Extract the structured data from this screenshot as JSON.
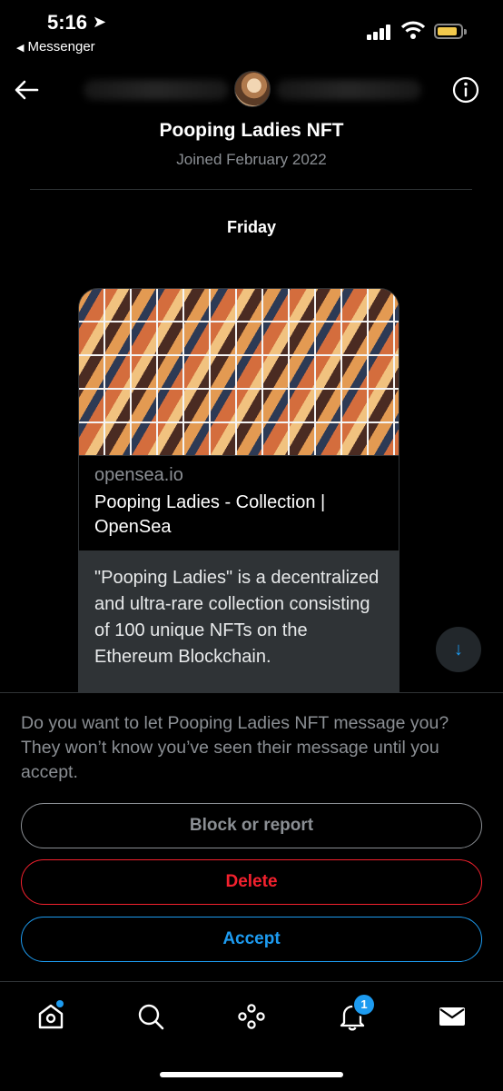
{
  "status_bar": {
    "time": "5:16",
    "back_app": "Messenger"
  },
  "header": {
    "name": "Pooping Ladies NFT",
    "joined": "Joined February 2022"
  },
  "conversation": {
    "day_label": "Friday",
    "card": {
      "domain": "opensea.io",
      "title": "Pooping Ladies - Collection | OpenSea",
      "description": "\"Pooping Ladies\" is a decentralized and ultra-rare collection consisting of 100 unique NFTs on the Ethereum Blockchain."
    }
  },
  "request": {
    "prompt": "Do you want to let Pooping Ladies NFT message you? They won’t know you’ve seen their message until you accept.",
    "block_label": "Block or report",
    "delete_label": "Delete",
    "accept_label": "Accept"
  },
  "tabbar": {
    "notifications_badge": "1"
  },
  "colors": {
    "accent": "#1d9bf0",
    "danger": "#f4212e",
    "muted": "#8b8f94",
    "background": "#000000"
  }
}
